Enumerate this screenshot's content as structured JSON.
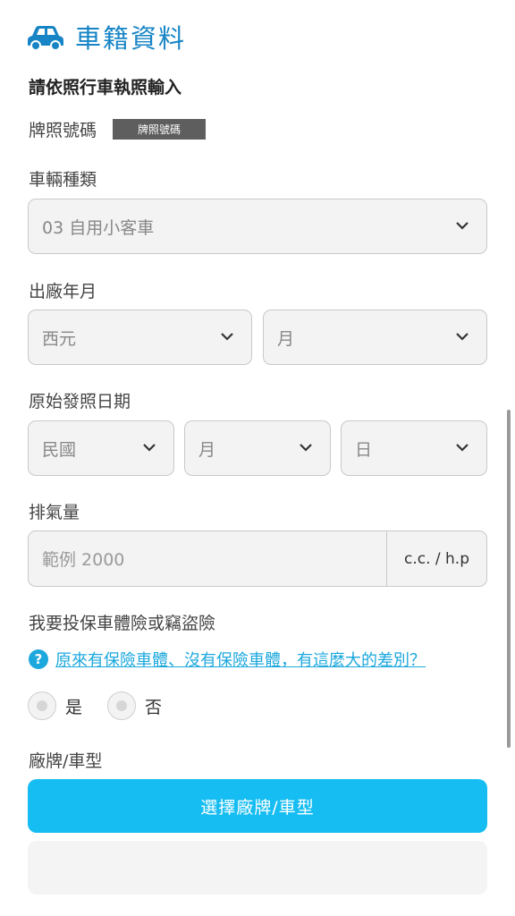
{
  "header": {
    "title": "車籍資料",
    "icon": "car-icon",
    "accent": "#1785c5"
  },
  "hint": "請依照行車執照輸入",
  "plate": {
    "label": "牌照號碼",
    "badge": "牌照號碼"
  },
  "vehicle_type": {
    "label": "車輛種類",
    "value": "03 自用小客車"
  },
  "manufacture_date": {
    "label": "出廠年月",
    "year": "西元",
    "month": "月"
  },
  "issue_date": {
    "label": "原始發照日期",
    "era": "民國",
    "month": "月",
    "day": "日"
  },
  "displacement": {
    "label": "排氣量",
    "placeholder": "範例 2000",
    "unit": "c.c. / h.p"
  },
  "insurance": {
    "label": "我要投保車體險或竊盜險",
    "help_link": "原來有保險車體、沒有保險車體，有這麼大的差別？",
    "options": [
      "是",
      "否"
    ]
  },
  "brand": {
    "label": "廠牌/車型",
    "button": "選擇廠牌/車型",
    "button_color": "#16bdf2"
  }
}
